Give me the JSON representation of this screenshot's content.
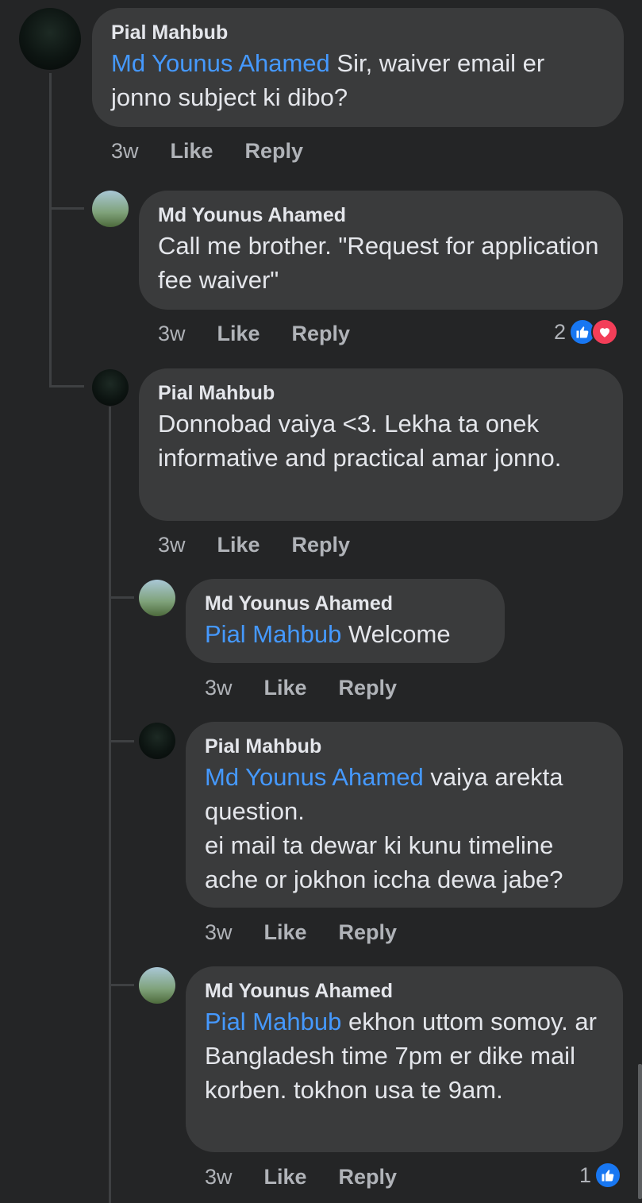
{
  "comments": [
    {
      "author": "Pial Mahbub",
      "mention": "Md Younus Ahamed",
      "text": " Sir, waiver email er jonno subject ki dibo?",
      "age": "3w",
      "like": "Like",
      "reply": "Reply"
    },
    {
      "author": "Md Younus Ahamed",
      "text": "Call me brother. \"Request for application fee waiver\"",
      "age": "3w",
      "like": "Like",
      "reply": "Reply",
      "reaction_count": "2"
    },
    {
      "author": "Pial Mahbub",
      "text": "Donnobad vaiya <3. Lekha ta onek informative and practical amar jonno.",
      "age": "3w",
      "like": "Like",
      "reply": "Reply"
    },
    {
      "author": "Md Younus Ahamed",
      "mention": "Pial Mahbub",
      "text": " Welcome",
      "age": "3w",
      "like": "Like",
      "reply": "Reply"
    },
    {
      "author": "Pial Mahbub",
      "mention": "Md Younus Ahamed",
      "text": " vaiya arekta question.",
      "text2": "ei mail ta dewar ki kunu timeline ache or jokhon iccha dewa jabe?",
      "age": "3w",
      "like": "Like",
      "reply": "Reply"
    },
    {
      "author": "Md Younus Ahamed",
      "mention": "Pial Mahbub",
      "text": " ekhon uttom somoy. ar Bangladesh time 7pm er dike mail korben. tokhon usa te 9am.",
      "age": "3w",
      "like": "Like",
      "reply": "Reply",
      "reaction_count": "1"
    }
  ],
  "icons": {
    "like_reaction": "thumbs-up-icon",
    "love_reaction": "heart-icon"
  },
  "colors": {
    "background": "#242526",
    "bubble": "#3a3b3c",
    "mention": "#4599ff",
    "like_blue": "#1877f2",
    "love_red": "#f33e58"
  }
}
